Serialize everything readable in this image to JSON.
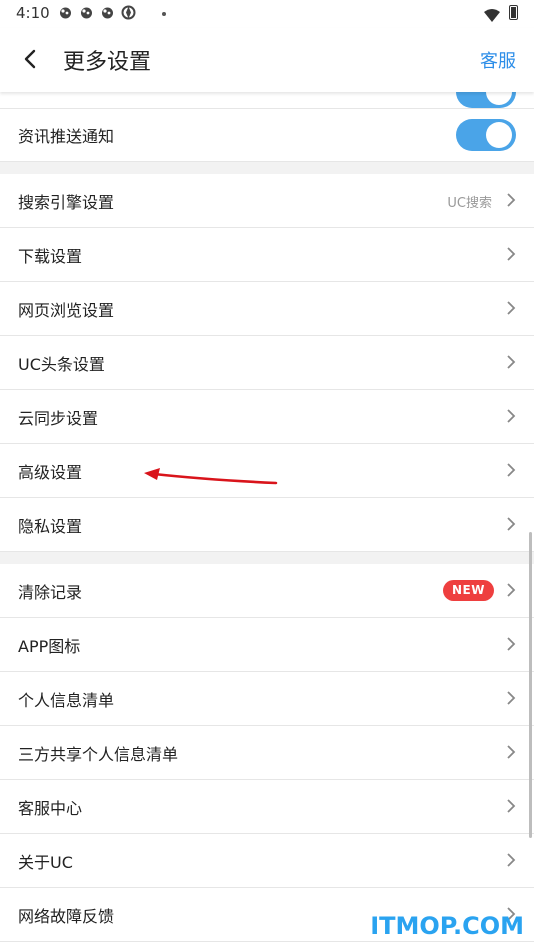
{
  "status": {
    "time": "4:10"
  },
  "header": {
    "title": "更多设置",
    "service_label": "客服"
  },
  "rows": {
    "push": "资讯推送通知",
    "search_engine": "搜索引擎设置",
    "search_engine_value": "UC搜索",
    "download": "下载设置",
    "browsing": "网页浏览设置",
    "uc_headline": "UC头条设置",
    "cloud_sync": "云同步设置",
    "advanced": "高级设置",
    "privacy": "隐私设置",
    "clear_history": "清除记录",
    "clear_badge": "NEW",
    "app_icon": "APP图标",
    "personal_info": "个人信息清单",
    "third_party": "三方共享个人信息清单",
    "support_center": "客服中心",
    "about": "关于UC",
    "network_feedback": "网络故障反馈"
  },
  "toggles": {
    "push_enabled": true
  },
  "colors": {
    "accent": "#4aa4e8",
    "link": "#2d8ee8",
    "badge": "#ee3f3f",
    "annotation": "#d9141b"
  },
  "watermark": "ITMOP.COM"
}
